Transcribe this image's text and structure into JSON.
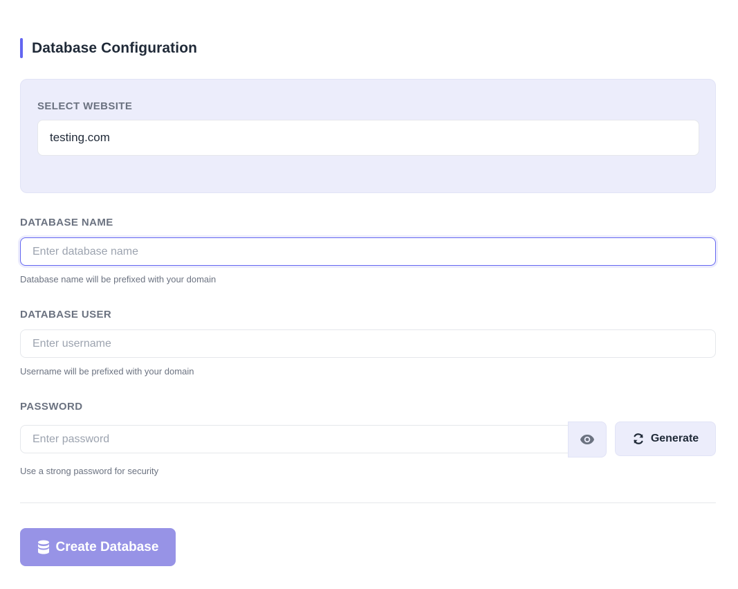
{
  "section": {
    "title": "Database Configuration"
  },
  "website": {
    "label": "Select Website",
    "selected": "testing.com"
  },
  "db_name": {
    "label": "Database Name",
    "value": "",
    "placeholder": "Enter database name",
    "help": "Database name will be prefixed with your domain"
  },
  "db_user": {
    "label": "Database User",
    "value": "",
    "placeholder": "Enter username",
    "help": "Username will be prefixed with your domain"
  },
  "password": {
    "label": "Password",
    "value": "",
    "placeholder": "Enter password",
    "help": "Use a strong password for security",
    "toggle_icon": "eye-icon",
    "generate_icon": "refresh-icon",
    "generate_label": "Generate"
  },
  "create": {
    "icon": "database-icon",
    "label": "Create Database"
  },
  "colors": {
    "accent": "#6366f1",
    "card_bg": "#ecedfb",
    "button_primary": "#9793e6"
  }
}
